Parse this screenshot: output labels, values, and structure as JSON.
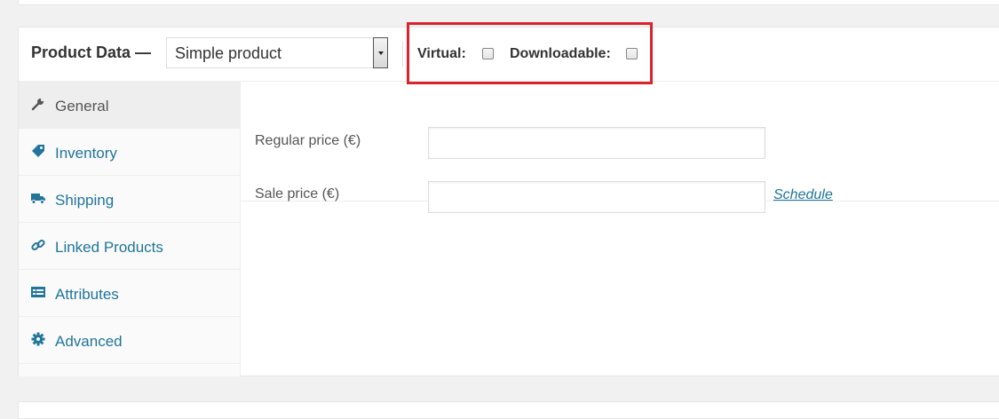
{
  "header": {
    "title": "Product Data —",
    "product_type": "Simple product",
    "virtual_label": "Virtual:",
    "downloadable_label": "Downloadable:",
    "virtual_checked": false,
    "downloadable_checked": false
  },
  "tabs": [
    {
      "label": "General",
      "icon": "wrench-icon",
      "active": true
    },
    {
      "label": "Inventory",
      "icon": "tag-icon",
      "active": false
    },
    {
      "label": "Shipping",
      "icon": "truck-icon",
      "active": false
    },
    {
      "label": "Linked Products",
      "icon": "link-icon",
      "active": false
    },
    {
      "label": "Attributes",
      "icon": "list-icon",
      "active": false
    },
    {
      "label": "Advanced",
      "icon": "gear-icon",
      "active": false
    }
  ],
  "general": {
    "regular_price_label": "Regular price (€)",
    "regular_price_value": "",
    "sale_price_label": "Sale price (€)",
    "sale_price_value": "",
    "schedule_link": "Schedule"
  },
  "colors": {
    "link": "#21759b",
    "highlight": "#d9232d",
    "active_tab": "#eeeeee"
  }
}
